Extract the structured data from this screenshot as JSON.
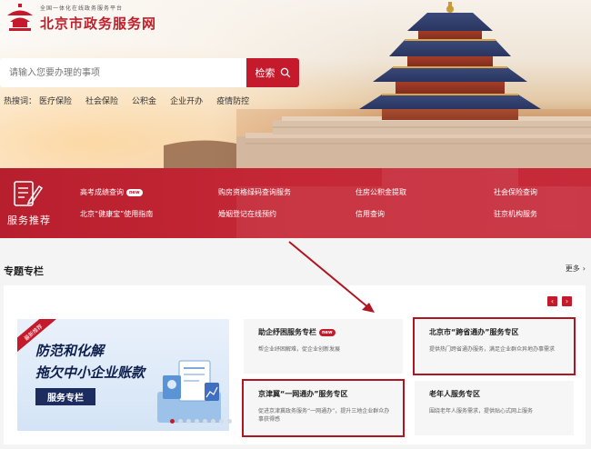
{
  "site": {
    "subtitle": "全国一体化在线政务服务平台",
    "title": "北京市政务服务网"
  },
  "search": {
    "placeholder": "请输入您要办理的事项",
    "button_label": "检索"
  },
  "hot": {
    "label": "热搜词：",
    "terms": [
      "医疗保险",
      "社会保险",
      "公积金",
      "企业开办",
      "疫情防控"
    ]
  },
  "service_recommend": {
    "title": "服务推荐",
    "badge": "new",
    "links": [
      "高考成绩查询",
      "购房资格绿码查询服务",
      "住房公积金提取",
      "社会保险查询",
      "北京“健康宝”使用指南",
      "婚姻登记在线预约",
      "信用查询",
      "驻京机构服务"
    ]
  },
  "topics": {
    "title": "专题专栏",
    "more": "更多",
    "banner": {
      "ribbon": "最新推荐",
      "line1": "防范和化解",
      "line2": "拖欠中小企业账款",
      "button": "服务专栏"
    },
    "cards": [
      {
        "title": "助企纾困服务专栏",
        "badge": "new",
        "desc": "帮企业纾困解难，促企业创新发展"
      },
      {
        "title": "北京市“跨省通办”服务专区",
        "desc": "提供热门跨省通办服务，满足企业群众异地办事需求"
      },
      {
        "title": "京津冀“一网通办”服务专区",
        "desc": "促进京津冀政务服务“一网通办”，提升三地企业群众办事获得感"
      },
      {
        "title": "老年人服务专区",
        "desc": "围绕老年人服务需求，提供贴心式网上服务"
      }
    ]
  },
  "colors": {
    "brand_red": "#c51a2c",
    "highlight_outline": "#b01522"
  }
}
